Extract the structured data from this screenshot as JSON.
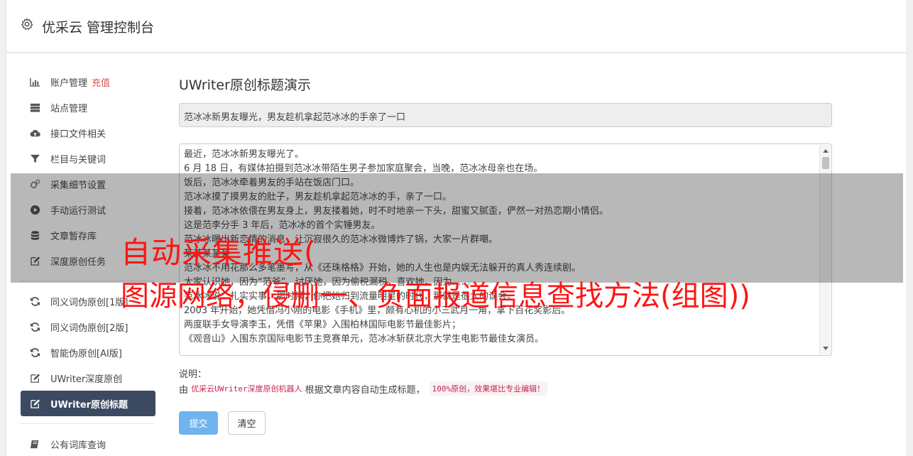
{
  "header": {
    "title": "优采云 管理控制台",
    "icon": "gear-icon"
  },
  "sidebar": {
    "group1": [
      {
        "label": "账户管理",
        "extra": "充值",
        "icon": "bar-chart-icon"
      },
      {
        "label": "站点管理",
        "icon": "server-icon"
      },
      {
        "label": "接口文件相关",
        "icon": "cloud-upload-icon"
      },
      {
        "label": "栏目与关键词",
        "icon": "filter-icon"
      },
      {
        "label": "采集细节设置",
        "icon": "gears-icon"
      },
      {
        "label": "手动运行测试",
        "icon": "play-circle-icon"
      },
      {
        "label": "文章暂存库",
        "icon": "database-icon"
      },
      {
        "label": "深度原创任务",
        "icon": "edit-icon"
      }
    ],
    "group2": [
      {
        "label": "同义词伪原创[1版]",
        "icon": "refresh-icon"
      },
      {
        "label": "同义词伪原创[2版]",
        "icon": "refresh-icon"
      },
      {
        "label": "智能伪原创[AI版]",
        "icon": "refresh-icon"
      },
      {
        "label": "UWriter深度原创",
        "icon": "edit-icon"
      },
      {
        "label": "UWriter原创标题",
        "icon": "edit-icon",
        "active": true
      }
    ],
    "group3": [
      {
        "label": "公有词库查询",
        "icon": "book-icon"
      }
    ]
  },
  "main": {
    "page_title": "UWriter原创标题演示",
    "title_value": "范冰冰新男友曝光，男友趁机拿起范冰冰的手亲了一口",
    "content_lines": [
      "最近，范冰冰新男友曝光了。",
      "6 月 18 日，有媒体拍摄到范冰冰带陌生男子参加家庭聚会，当晚，范冰冰母亲也在场。",
      "饭后，范冰冰牵着男友的手站在饭店门口。",
      "范冰冰摸了摸男友的肚子，男友趁机拿起范冰冰的手，亲了一口。",
      "接着，范冰冰依偎在男友身上，男友搂着她，时不时地亲一下头，甜蜜又腻歪，俨然一对热恋期小情侣。",
      "这是范李分手 3 年后，范冰冰的首个实锤男友。",
      "范冰冰曝出新恋情的消息，让沉寂很久的范冰冰微博炸了锅，大家一片群嘲。",
      "某某某某某",
      "范冰冰不用花那么多笔墨写，从《还珠格格》开始，她的人生也是内娱无法躲开的真人秀连续剧。",
      "大家认识她，因为“范爷”，讨厌她，因为偷税漏税，喜欢她，因为……",
      "范冰冰说：扎实实事，那时候，你把她归到流量明星的时代，那就是很大的误会。",
      "2003 年开始，她凭借冯小刚的电影《手机》里，颇有心机的小三武月一角，拿下百花奖影后。",
      "两度联手女导演李玉，凭借《苹果》入围柏林国际电影节最佳影片；",
      "《观音山》入围东京国际电影节主竞赛单元，范冰冰斩获北京大学生电影节最佳女演员。"
    ],
    "note_label": "说明：",
    "note_prefix": "由",
    "note_red": "优采云UWriter深度原创机器人",
    "note_middle": "根据文章内容自动生成标题，",
    "note_badge": "100%原创，效果堪比专业编辑！",
    "submit_label": "提交",
    "clear_label": "清空"
  },
  "watermark": {
    "line1": "自动采集推送(",
    "line2": "图源网络，侵删一、负面报道信息查找方法(组图))"
  }
}
